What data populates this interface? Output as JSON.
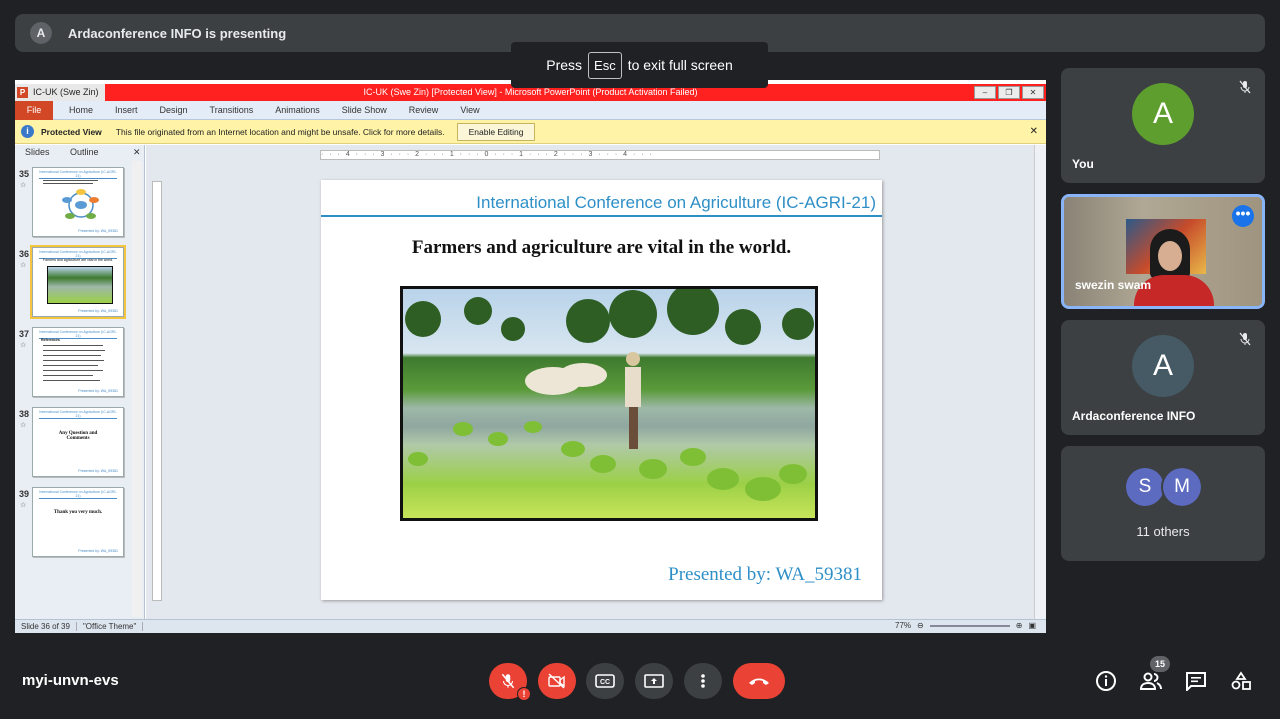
{
  "banner": {
    "avatar": "A",
    "text": "Ardaconference INFO is presenting"
  },
  "esc_toast": {
    "press": "Press",
    "key": "Esc",
    "rest": "to exit full screen"
  },
  "ppt": {
    "window_left": "IC-UK (Swe Zin) [I",
    "window_title": "IC-UK (Swe Zin) [Protected View] - Microsoft PowerPoint (Product Activation Failed)",
    "ribbon_tabs": [
      "File",
      "Home",
      "Insert",
      "Design",
      "Transitions",
      "Animations",
      "Slide Show",
      "Review",
      "View"
    ],
    "protected": {
      "label": "Protected View",
      "message": "This file originated from an Internet location and might be unsafe. Click for more details.",
      "button": "Enable Editing"
    },
    "pane_tabs": [
      "Slides",
      "Outline"
    ],
    "thumbnails": [
      {
        "num": "35",
        "header": "International Conference on Agriculture (IC-AGRI-21)",
        "text": "",
        "footer": "Presented by: WA_59381"
      },
      {
        "num": "36",
        "header": "International Conference on Agriculture (IC-AGRI-21)",
        "text": "Farmers and agriculture are vital in the world.",
        "footer": "Presented by: WA_59381"
      },
      {
        "num": "37",
        "header": "International Conference on Agriculture (IC-AGRI-21)",
        "text": "References",
        "footer": "Presented by: WA_59381"
      },
      {
        "num": "38",
        "header": "International Conference on Agriculture (IC-AGRI-21)",
        "text": "Any Question and Comments",
        "footer": "Presented by: WA_59381"
      },
      {
        "num": "39",
        "header": "International Conference on Agriculture (IC-AGRI-21)",
        "text": "Thank you very much.",
        "footer": "Presented by: WA_59381"
      }
    ],
    "ruler_text": "· · · 4 · · · 3 · · · 2 · · · 1 · · · 0 · · · 1 · · · 2 · · · 3 · · · 4 · · ·",
    "slide": {
      "conference": "International Conference on Agriculture (IC-AGRI-21)",
      "heading": "Farmers and agriculture are vital in the world.",
      "presenter": "Presented by:  WA_59381"
    },
    "status": {
      "slide": "Slide 36 of 39",
      "theme": "\"Office Theme\"",
      "zoom": "77%"
    }
  },
  "participants": [
    {
      "name": "You",
      "initial": "A",
      "color": "#5e9e2e",
      "muted": true
    },
    {
      "name": "swezin swam",
      "more_icon": "more-vert-icon"
    },
    {
      "name": "Ardaconference INFO",
      "initial": "A",
      "color": "#455a64",
      "muted": true
    },
    {
      "name": "11 others",
      "initials": [
        "S",
        "M"
      ],
      "colors": [
        "#5c6bc0",
        "#5c6bc0"
      ]
    }
  ],
  "meeting": {
    "code": "myi-unvn-evs",
    "participant_count": "15"
  },
  "colors": {
    "end_call": "#ea4335",
    "background": "#202124",
    "tile": "#3c4043"
  }
}
